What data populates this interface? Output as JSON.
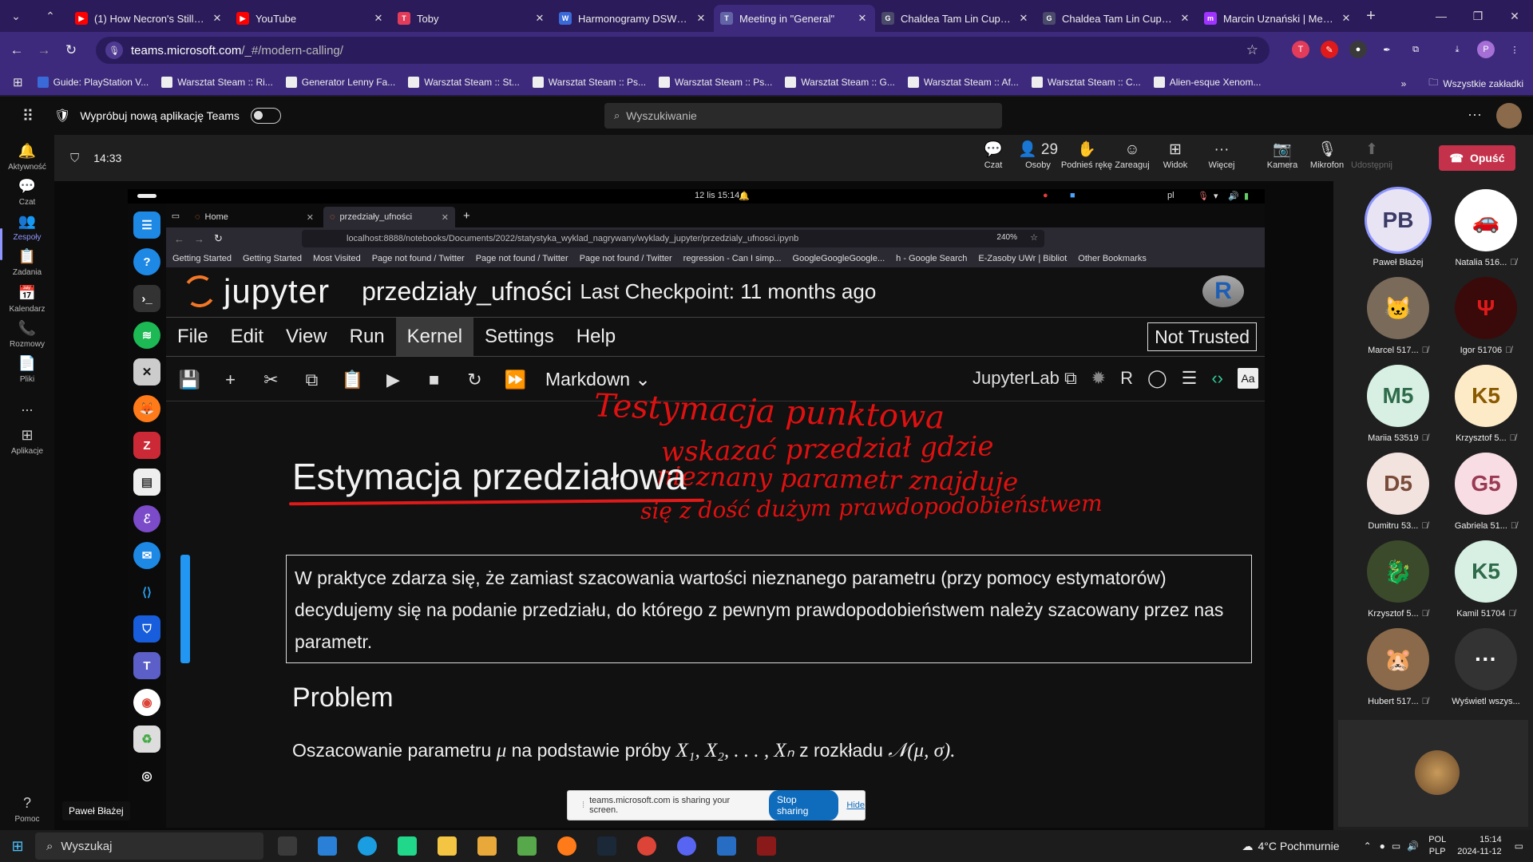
{
  "browser": {
    "tabs": [
      {
        "label": "(1) How Necron's Stilling",
        "color": "#ff0000",
        "glyph": "▶"
      },
      {
        "label": "YouTube",
        "color": "#ff0000",
        "glyph": "▶"
      },
      {
        "label": "Toby",
        "color": "#e23c5a",
        "glyph": "T"
      },
      {
        "label": "Harmonogramy DSW - P",
        "color": "#3a6ad8",
        "glyph": "W"
      },
      {
        "label": "Meeting in \"General\"",
        "color": "#6264a7",
        "glyph": "T",
        "active": true
      },
      {
        "label": "Chaldea Tam Lin Cup - W",
        "color": "#4a4a6a",
        "glyph": "G"
      },
      {
        "label": "Chaldea Tam Lin Cup - E",
        "color": "#4a4a6a",
        "glyph": "G"
      },
      {
        "label": "Marcin Uznański | Messe",
        "color": "#a033ff",
        "glyph": "m"
      }
    ],
    "url_host": "teams.microsoft.com",
    "url_path": "/_#/modern-calling/",
    "bookmarks": [
      "Guide: PlayStation V...",
      "Warsztat Steam :: Ri...",
      "Generator Lenny Fa...",
      "Warsztat Steam :: St...",
      "Warsztat Steam :: Ps...",
      "Warsztat Steam :: Ps...",
      "Warsztat Steam :: G...",
      "Warsztat Steam :: Af...",
      "Warsztat Steam :: C...",
      "Alien-esque Xenom..."
    ],
    "all_bookmarks": "Wszystkie zakładki"
  },
  "teams": {
    "try_new": "Wypróbuj nową aplikację Teams",
    "search_placeholder": "Wyszukiwanie",
    "rail": [
      {
        "label": "Aktywność",
        "icon": "bell-icon",
        "glyph": "🔔"
      },
      {
        "label": "Czat",
        "icon": "chat-icon",
        "glyph": "💬"
      },
      {
        "label": "Zespoły",
        "icon": "teams-icon",
        "glyph": "👥",
        "active": true
      },
      {
        "label": "Zadania",
        "icon": "tasks-icon",
        "glyph": "📋"
      },
      {
        "label": "Kalendarz",
        "icon": "calendar-icon",
        "glyph": "📅"
      },
      {
        "label": "Rozmowy",
        "icon": "phone-icon",
        "glyph": "📞"
      },
      {
        "label": "Pliki",
        "icon": "files-icon",
        "glyph": "📄"
      },
      {
        "label": "...",
        "icon": "more-icon",
        "glyph": ""
      },
      {
        "label": "Aplikacje",
        "icon": "apps-icon",
        "glyph": "⊞"
      }
    ],
    "help": "Pomoc",
    "meeting_time": "14:33",
    "controls": [
      {
        "label": "Czat",
        "glyph": "💬"
      },
      {
        "label": "Osoby",
        "glyph": "👤 29"
      },
      {
        "label": "Podnieś rękę",
        "glyph": "✋"
      },
      {
        "label": "Zareaguj",
        "glyph": "☺"
      },
      {
        "label": "Widok",
        "glyph": "⊞"
      },
      {
        "label": "Więcej",
        "glyph": "···"
      },
      {
        "label": "Kamera",
        "glyph": "📷"
      },
      {
        "label": "Mikrofon",
        "glyph": "🎙"
      },
      {
        "label": "Udostępnij",
        "glyph": "⬆",
        "disabled": true
      }
    ],
    "leave": "Opuść",
    "participants": [
      {
        "name": "Paweł Błażej",
        "initials": "PB",
        "bg": "#e8e4f4",
        "fg": "#3a3a66",
        "muted": false
      },
      {
        "name": "Natalia 516...",
        "initials": "🚗",
        "bg": "#ffffff",
        "fg": "#cc0000",
        "muted": true
      },
      {
        "name": "Marcel 517...",
        "initials": "🐱",
        "bg": "#7a6a5a",
        "fg": "#fff",
        "muted": true
      },
      {
        "name": "Igor 51706",
        "initials": "Ψ",
        "bg": "#3a0a0a",
        "fg": "#e01a1a",
        "muted": true
      },
      {
        "name": "Mariia 53519",
        "initials": "M5",
        "bg": "#d7f0e3",
        "fg": "#2f6b4a",
        "muted": true
      },
      {
        "name": "Krzysztof 5...",
        "initials": "K5",
        "bg": "#fdebc8",
        "fg": "#8a5a00",
        "muted": true
      },
      {
        "name": "Dumitru 53...",
        "initials": "D5",
        "bg": "#f2e3df",
        "fg": "#7a4a3a",
        "muted": true
      },
      {
        "name": "Gabriela 51...",
        "initials": "G5",
        "bg": "#f8dde4",
        "fg": "#9a3a55",
        "muted": true
      },
      {
        "name": "Krzysztof 5...",
        "initials": "🐉",
        "bg": "#3a4a2a",
        "fg": "#7fdc3a",
        "muted": true
      },
      {
        "name": "Kamil 51704",
        "initials": "K5",
        "bg": "#d7f0e3",
        "fg": "#2f6b4a",
        "muted": true
      },
      {
        "name": "Hubert 517...",
        "initials": "🐹",
        "bg": "#8a6a4a",
        "fg": "#fff",
        "muted": true
      },
      {
        "name": "Wyświetl wszys...",
        "initials": "···",
        "bg": "#333333",
        "fg": "#fff",
        "muted": false
      }
    ],
    "tooltip": "Paweł Błażej"
  },
  "shared": {
    "ubuntu_clock": "12 lis  15:14",
    "ubuntu_lang": "pl",
    "ff_tabs": [
      "Home",
      "przedziały_ufności"
    ],
    "ff_url": "localhost:8888/notebooks/Documents/2022/statystyka_wyklad_nagrywany/wyklady_jupyter/przedzialy_ufnosci.ipynb",
    "ff_zoom": "240%",
    "ff_bookmarks": [
      "Getting Started",
      "Getting Started",
      "Most Visited",
      "Page not found / Twitter",
      "Page not found / Twitter",
      "Page not found / Twitter",
      "regression - Can I simp...",
      "GoogleGoogleGoogle...",
      "h - Google Search",
      "E-Zasoby UWr | Bibliot",
      "Other Bookmarks"
    ],
    "jupyter": {
      "brand": "jupyter",
      "notebook": "przedziały_ufności",
      "checkpoint": "Last Checkpoint: 11 months ago",
      "menu": [
        "File",
        "Edit",
        "View",
        "Run",
        "Kernel",
        "Settings",
        "Help"
      ],
      "selected_menu": "Kernel",
      "not_trusted": "Not Trusted",
      "cell_type": "Markdown",
      "jupyterlab": "JupyterLab",
      "kernel": "R",
      "heading": "Estymacja przedziałowa",
      "md_text": "W praktyce zdarza się, że zamiast szacowania wartości nieznanego parametru (przy pomocy estymatorów) decydujemy się na podanie przedziału, do którego z pewnym prawdopodobieństwem należy szacowany przez nas parametr.",
      "problem": "Problem",
      "problem_text_before": "Oszacowanie parametru",
      "problem_text_mid": "na podstawie próby",
      "problem_text_after": "z rozkładu",
      "math_mu": "μ",
      "math_sample": "X₁, X₂, . . . , Xₙ",
      "math_dist": "𝒩(μ, σ).",
      "annotations": [
        "Testymacja punktowa",
        "wskazać przedział gdzie",
        "nieznany parametr znajduje",
        "się z dość dużym prawdopodobieństwem"
      ]
    },
    "share_notice": "teams.microsoft.com is sharing your screen.",
    "stop_sharing": "Stop sharing",
    "hide": "Hide"
  },
  "taskbar": {
    "search": "Wyszukaj",
    "weather": "4°C  Pochmurnie",
    "lang1": "POL",
    "lang2": "PLP",
    "time": "15:14",
    "date": "2024-11-12"
  }
}
